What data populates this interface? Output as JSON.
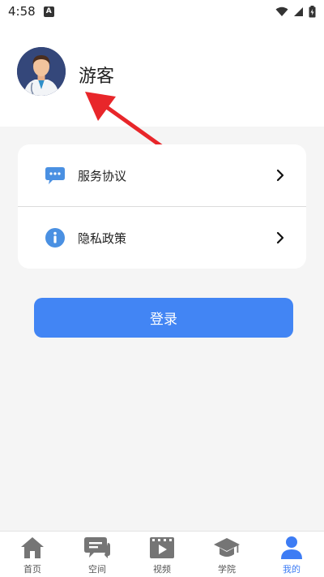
{
  "status_bar": {
    "time": "4:58",
    "sim_badge": "A"
  },
  "profile": {
    "username": "游客",
    "avatar_icon": "doctor-avatar"
  },
  "menu": {
    "items": [
      {
        "label": "服务协议",
        "icon": "message-bubble-icon"
      },
      {
        "label": "隐私政策",
        "icon": "info-icon"
      }
    ]
  },
  "login_button": {
    "label": "登录"
  },
  "tabbar": {
    "tabs": [
      {
        "label": "首页",
        "icon": "home-icon",
        "active": false
      },
      {
        "label": "空间",
        "icon": "chat-icon",
        "active": false
      },
      {
        "label": "视频",
        "icon": "video-icon",
        "active": false
      },
      {
        "label": "学院",
        "icon": "graduation-cap-icon",
        "active": false
      },
      {
        "label": "我的",
        "icon": "person-icon",
        "active": true
      }
    ]
  },
  "colors": {
    "accent": "#4285f4",
    "active_tab": "#3d7cf4",
    "annotation_arrow": "#e8262a",
    "inactive_tab_icon": "#757575"
  }
}
